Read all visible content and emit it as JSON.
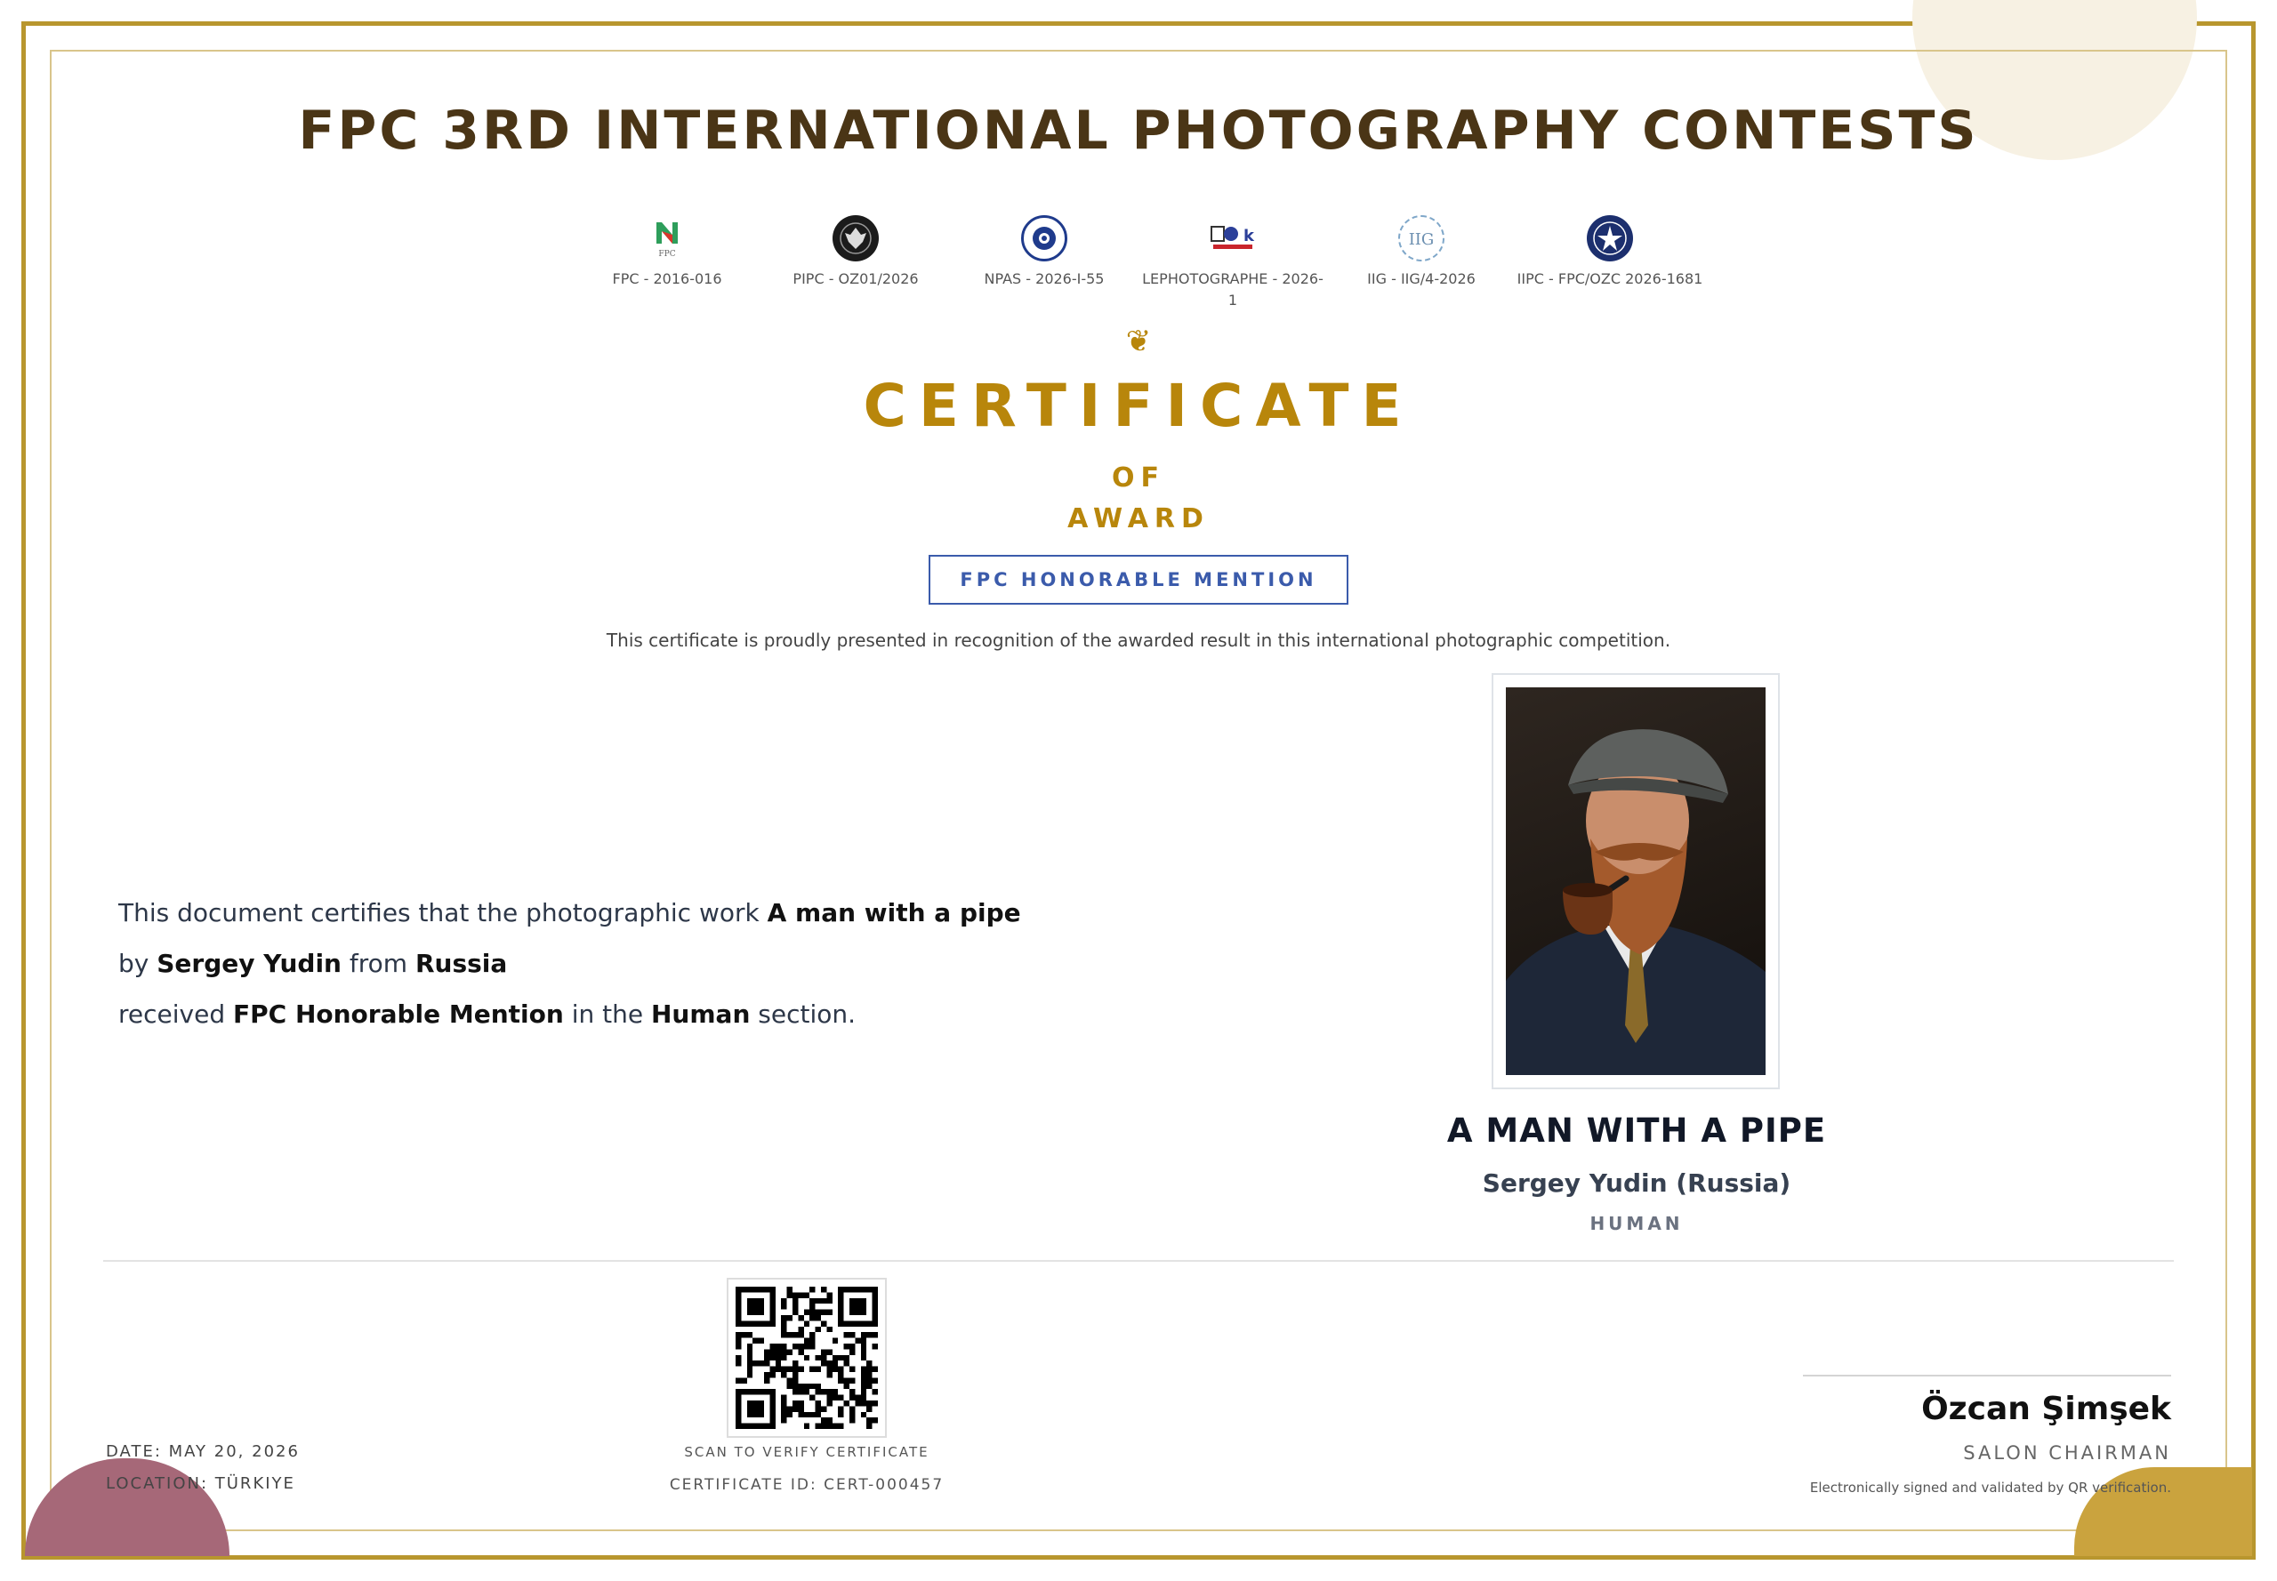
{
  "header": {
    "title": "FPC 3RD INTERNATIONAL PHOTOGRAPHY CONTESTS"
  },
  "patronages": [
    {
      "label": "FPC - 2016-016",
      "icon": "fpc-logo-icon"
    },
    {
      "label": "PIPC - OZ01/2026",
      "icon": "pipc-logo-icon"
    },
    {
      "label": "NPAS - 2026-I-55",
      "icon": "npas-logo-icon"
    },
    {
      "label": "LEPHOTOGRAPHE - 2026-1",
      "icon": "lephotographe-logo-icon"
    },
    {
      "label": "IIG - IIG/4-2026",
      "icon": "iig-logo-icon"
    },
    {
      "label": "IIPC - FPC/OZC 2026-1681",
      "icon": "iipc-logo-icon"
    }
  ],
  "certificate": {
    "flourish": "❦",
    "word": "CERTIFICATE",
    "of": "OF",
    "award": "AWARD",
    "badge": "FPC HONORABLE MENTION",
    "presented": "This certificate is proudly presented in recognition of the awarded result in this international photographic competition."
  },
  "statement": {
    "line1_prefix": "This document certifies that the photographic work ",
    "work_title": "A man with a pipe",
    "line2_prefix": "by ",
    "author": "Sergey Yudin",
    "line2_mid": " from ",
    "country": "Russia",
    "line3_prefix": "received ",
    "award_name": "FPC Honorable Mention",
    "line3_mid": " in the ",
    "section": "Human",
    "line3_suffix": " section."
  },
  "work": {
    "title": "A MAN WITH A PIPE",
    "author_line": "Sergey Yudin (Russia)",
    "section": "HUMAN"
  },
  "footer": {
    "date": "DATE: MAY 20, 2026",
    "location": "LOCATION: TÜRKIYE",
    "qr_caption": "SCAN TO VERIFY CERTIFICATE",
    "cert_id": "CERTIFICATE ID: CERT-000457",
    "signer_name": "Özcan Şimşek",
    "signer_title": "SALON CHAIRMAN",
    "signer_note": "Electronically signed and validated by QR verification."
  },
  "colors": {
    "gold": "#b8860b",
    "frame": "#b8962e",
    "title_brown": "#4a3516",
    "badge_blue": "#3b5bab"
  }
}
